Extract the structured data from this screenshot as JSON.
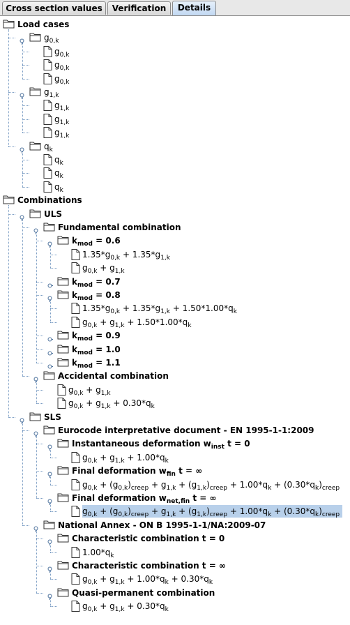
{
  "tabs": [
    {
      "label": "Cross section values",
      "active": false
    },
    {
      "label": "Verification",
      "active": false
    },
    {
      "label": "Details",
      "active": true
    }
  ],
  "tree": [
    {
      "depth": 0,
      "type": "folder",
      "html": "Load cases"
    },
    {
      "depth": 1,
      "type": "plain",
      "html": "g<sub>0,k</sub>"
    },
    {
      "depth": 2,
      "type": "leaf",
      "html": "g<sub>0,k</sub>"
    },
    {
      "depth": 2,
      "type": "leaf",
      "html": "g<sub>0,k</sub>"
    },
    {
      "depth": 2,
      "type": "leaf",
      "html": "g<sub>0,k</sub>"
    },
    {
      "depth": 1,
      "type": "plain",
      "html": "g<sub>1,k</sub>"
    },
    {
      "depth": 2,
      "type": "leaf",
      "html": "g<sub>1,k</sub>"
    },
    {
      "depth": 2,
      "type": "leaf",
      "html": "g<sub>1,k</sub>"
    },
    {
      "depth": 2,
      "type": "leaf",
      "html": "g<sub>1,k</sub>"
    },
    {
      "depth": 1,
      "type": "plain",
      "html": "q<sub>k</sub>"
    },
    {
      "depth": 2,
      "type": "leaf",
      "html": "q<sub>k</sub>"
    },
    {
      "depth": 2,
      "type": "leaf",
      "html": "q<sub>k</sub>"
    },
    {
      "depth": 2,
      "type": "leaf",
      "html": "q<sub>k</sub>"
    },
    {
      "depth": 0,
      "type": "folder",
      "html": "Combinations"
    },
    {
      "depth": 1,
      "type": "folder",
      "html": "ULS"
    },
    {
      "depth": 2,
      "type": "folder",
      "html": "Fundamental combination"
    },
    {
      "depth": 3,
      "type": "folder",
      "html": "k<sub>mod</sub> = 0.6"
    },
    {
      "depth": 4,
      "type": "leaf",
      "html": "1.35*g<sub>0,k</sub> + 1.35*g<sub>1,k</sub>"
    },
    {
      "depth": 4,
      "type": "leaf",
      "html": "g<sub>0,k</sub> + g<sub>1,k</sub>"
    },
    {
      "depth": 3,
      "type": "folder",
      "collapsed": true,
      "html": "k<sub>mod</sub> = 0.7"
    },
    {
      "depth": 3,
      "type": "folder",
      "html": "k<sub>mod</sub> = 0.8"
    },
    {
      "depth": 4,
      "type": "leaf",
      "html": "1.35*g<sub>0,k</sub> + 1.35*g<sub>1,k</sub> + 1.50*1.00*q<sub>k</sub>"
    },
    {
      "depth": 4,
      "type": "leaf",
      "html": "g<sub>0,k</sub> + g<sub>1,k</sub> + 1.50*1.00*q<sub>k</sub>"
    },
    {
      "depth": 3,
      "type": "folder",
      "collapsed": true,
      "html": "k<sub>mod</sub> = 0.9"
    },
    {
      "depth": 3,
      "type": "folder",
      "collapsed": true,
      "html": "k<sub>mod</sub> = 1.0"
    },
    {
      "depth": 3,
      "type": "folder",
      "collapsed": true,
      "html": "k<sub>mod</sub> = 1.1"
    },
    {
      "depth": 2,
      "type": "folder",
      "html": "Accidental combination"
    },
    {
      "depth": 3,
      "type": "leaf",
      "html": "g<sub>0,k</sub> + g<sub>1,k</sub>"
    },
    {
      "depth": 3,
      "type": "leaf",
      "html": "g<sub>0,k</sub> + g<sub>1,k</sub> + 0.30*q<sub>k</sub>"
    },
    {
      "depth": 1,
      "type": "folder",
      "html": "SLS"
    },
    {
      "depth": 2,
      "type": "folder",
      "html": "Eurocode interpretative document - EN 1995-1-1:2009"
    },
    {
      "depth": 3,
      "type": "folder",
      "html": "Instantaneous deformation w<sub>inst</sub> t = 0"
    },
    {
      "depth": 4,
      "type": "leaf",
      "html": "g<sub>0,k</sub> + g<sub>1,k</sub> + 1.00*q<sub>k</sub>"
    },
    {
      "depth": 3,
      "type": "folder",
      "html": "Final deformation w<sub>fin</sub> t = ∞"
    },
    {
      "depth": 4,
      "type": "leaf",
      "html": "g<sub>0,k</sub> + (g<sub>0,k</sub>)<sub>creep</sub> + g<sub>1,k</sub> + (g<sub>1,k</sub>)<sub>creep</sub> + 1.00*q<sub>k</sub> + (0.30*q<sub>k</sub>)<sub>creep</sub>"
    },
    {
      "depth": 3,
      "type": "folder",
      "html": "Final deformation w<sub>net,fin</sub> t = ∞"
    },
    {
      "depth": 4,
      "type": "leaf",
      "selected": true,
      "html": "g<sub>0,k</sub> + (g<sub>0,k</sub>)<sub>creep</sub> + g<sub>1,k</sub> + (g<sub>1,k</sub>)<sub>creep</sub> + 1.00*q<sub>k</sub> + (0.30*q<sub>k</sub>)<sub>creep</sub>"
    },
    {
      "depth": 2,
      "type": "folder",
      "html": "National Annex - ON B 1995-1-1/NA:2009-07"
    },
    {
      "depth": 3,
      "type": "folder",
      "html": "Characteristic combination t = 0"
    },
    {
      "depth": 4,
      "type": "leaf",
      "html": "1.00*q<sub>k</sub>"
    },
    {
      "depth": 3,
      "type": "folder",
      "html": "Characteristic combination t = ∞"
    },
    {
      "depth": 4,
      "type": "leaf",
      "html": "g<sub>0,k</sub> + g<sub>1,k</sub> + 1.00*q<sub>k</sub> + 0.30*q<sub>k</sub>"
    },
    {
      "depth": 3,
      "type": "folder",
      "html": "Quasi-permanent combination"
    },
    {
      "depth": 4,
      "type": "leaf",
      "html": "g<sub>0,k</sub> + g<sub>1,k</sub> + 0.30*q<sub>k</sub>"
    }
  ]
}
